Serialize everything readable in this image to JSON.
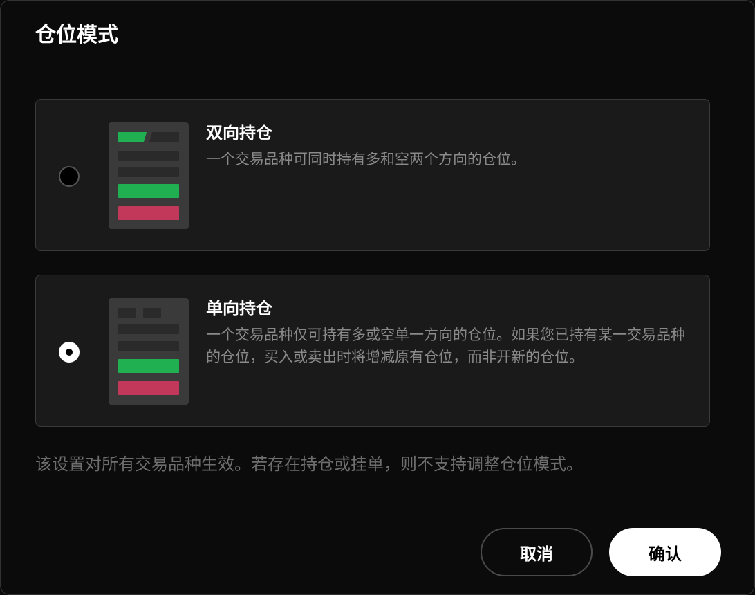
{
  "dialog": {
    "title": "仓位模式",
    "options": [
      {
        "title": "双向持仓",
        "description": "一个交易品种可同时持有多和空两个方向的仓位。",
        "selected": false
      },
      {
        "title": "单向持仓",
        "description": "一个交易品种仅可持有多或空单一方向的仓位。如果您已持有某一交易品种的仓位，买入或卖出时将增减原有仓位，而非开新的仓位。",
        "selected": true
      }
    ],
    "note": "该设置对所有交易品种生效。若存在持仓或挂单，则不支持调整仓位模式。",
    "buttons": {
      "cancel": "取消",
      "confirm": "确认"
    }
  },
  "colors": {
    "background": "#0b0b0b",
    "card": "#1a1a1a",
    "green": "#20b052",
    "red": "#c2385a"
  }
}
